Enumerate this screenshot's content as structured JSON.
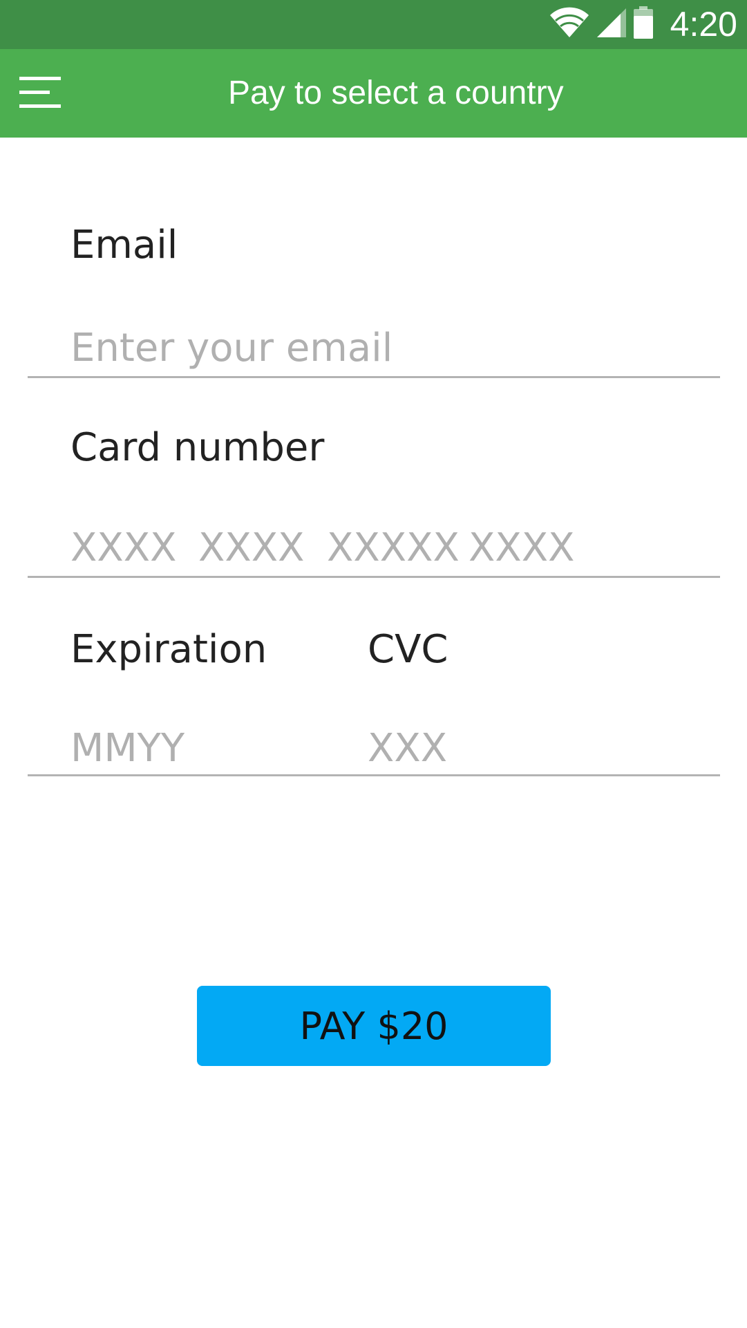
{
  "status_bar": {
    "time": "4:20",
    "icons": [
      "wifi-icon",
      "signal-icon",
      "battery-icon"
    ]
  },
  "app_bar": {
    "menu_icon": "hamburger-menu-icon",
    "title": "Pay to select a country"
  },
  "form": {
    "email": {
      "label": "Email",
      "placeholder": "Enter your email"
    },
    "card_number": {
      "label": "Card number",
      "placeholder_groups": [
        "XXXX",
        "XXXX",
        "XXXXX",
        "XXXX"
      ]
    },
    "expiration": {
      "label": "Expiration",
      "placeholder": "MMYY"
    },
    "cvc": {
      "label": "CVC",
      "placeholder": "XXX"
    }
  },
  "pay_button": {
    "label": "PAY $20"
  },
  "colors": {
    "status_bar": "#3f8f47",
    "app_bar": "#4caf50",
    "pay_button": "#03a9f4",
    "placeholder_text": "#b0b0b0",
    "field_underline": "#b3b3b3"
  }
}
